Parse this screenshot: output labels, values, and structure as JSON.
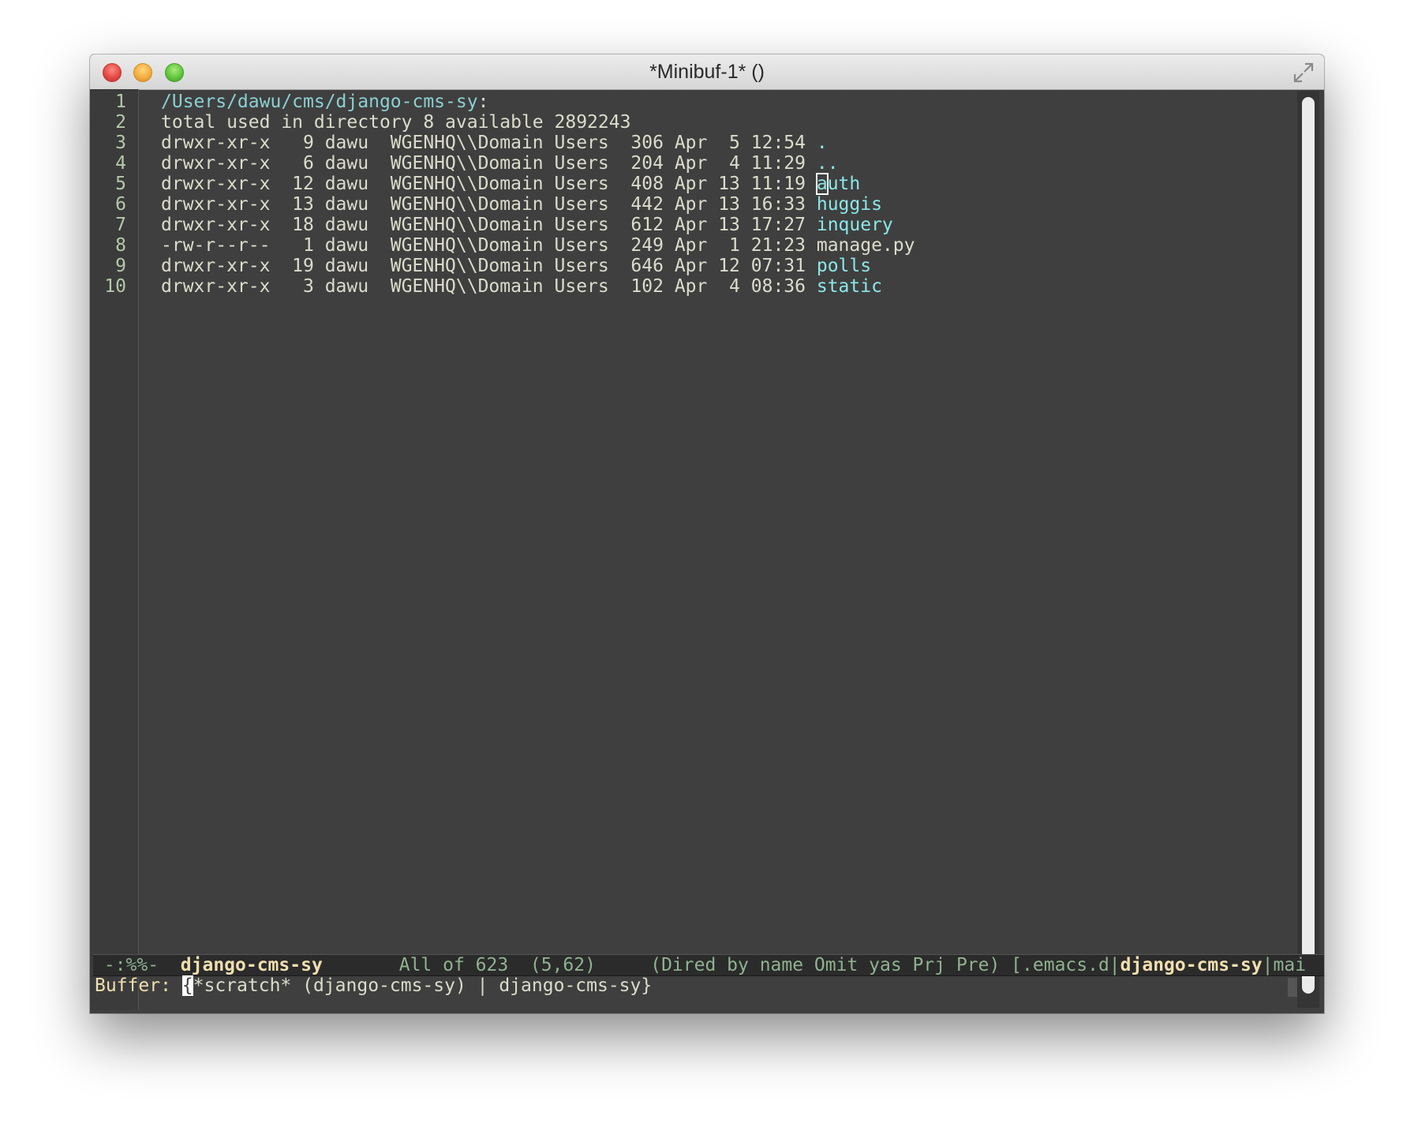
{
  "window": {
    "title": "*Minibuf-1* ()"
  },
  "buffer": {
    "lines": [
      {
        "n": "1",
        "text": "/Users/dawu/cms/django-cms-sy",
        "suffix": ":"
      },
      {
        "n": "2",
        "text": "total used in directory 8 available 2892243"
      },
      {
        "n": "3",
        "meta": "drwxr-xr-x   9 dawu  WGENHQ\\\\Domain Users  306 Apr  5 12:54 ",
        "name": "."
      },
      {
        "n": "4",
        "meta": "drwxr-xr-x   6 dawu  WGENHQ\\\\Domain Users  204 Apr  4 11:29 ",
        "name": ".."
      },
      {
        "n": "5",
        "meta": "drwxr-xr-x  12 dawu  WGENHQ\\\\Domain Users  408 Apr 13 11:19 ",
        "name_first": "a",
        "name_rest": "uth"
      },
      {
        "n": "6",
        "meta": "drwxr-xr-x  13 dawu  WGENHQ\\\\Domain Users  442 Apr 13 16:33 ",
        "name": "huggis"
      },
      {
        "n": "7",
        "meta": "drwxr-xr-x  18 dawu  WGENHQ\\\\Domain Users  612 Apr 13 17:27 ",
        "name": "inquery"
      },
      {
        "n": "8",
        "meta": "-rw-r--r--   1 dawu  WGENHQ\\\\Domain Users  249 Apr  1 21:23 ",
        "name": "manage.py"
      },
      {
        "n": "9",
        "meta": "drwxr-xr-x  19 dawu  WGENHQ\\\\Domain Users  646 Apr 12 07:31 ",
        "name": "polls"
      },
      {
        "n": "10",
        "meta": "drwxr-xr-x   3 dawu  WGENHQ\\\\Domain Users  102 Apr  4 08:36 ",
        "name": "static"
      }
    ]
  },
  "modeline": {
    "status": " -:%%-  ",
    "buffer_name": "django-cms-sy",
    "position": "       All of 623  (5,62)     ",
    "modes": "(Dired by name Omit yas Prj Pre) [.emacs.d|",
    "project": "django-cms-sy",
    "tail": "|mai"
  },
  "minibuffer": {
    "prompt": "Buffer: ",
    "cursor_char": "{",
    "text": "*scratch* (django-cms-sy) | django-cms-sy}"
  },
  "colors": {
    "background": "#3f3f3f",
    "foreground": "#dcdccc",
    "directory": "#8ce7e7",
    "header": "#8cd0d3",
    "line_number": "#b3c9a8",
    "modeline_highlight": "#f0dfaf"
  },
  "icons": {
    "close": "close-traffic-light",
    "minimize": "minimize-traffic-light",
    "zoom": "zoom-traffic-light",
    "fullscreen": "fullscreen-arrows-icon"
  }
}
